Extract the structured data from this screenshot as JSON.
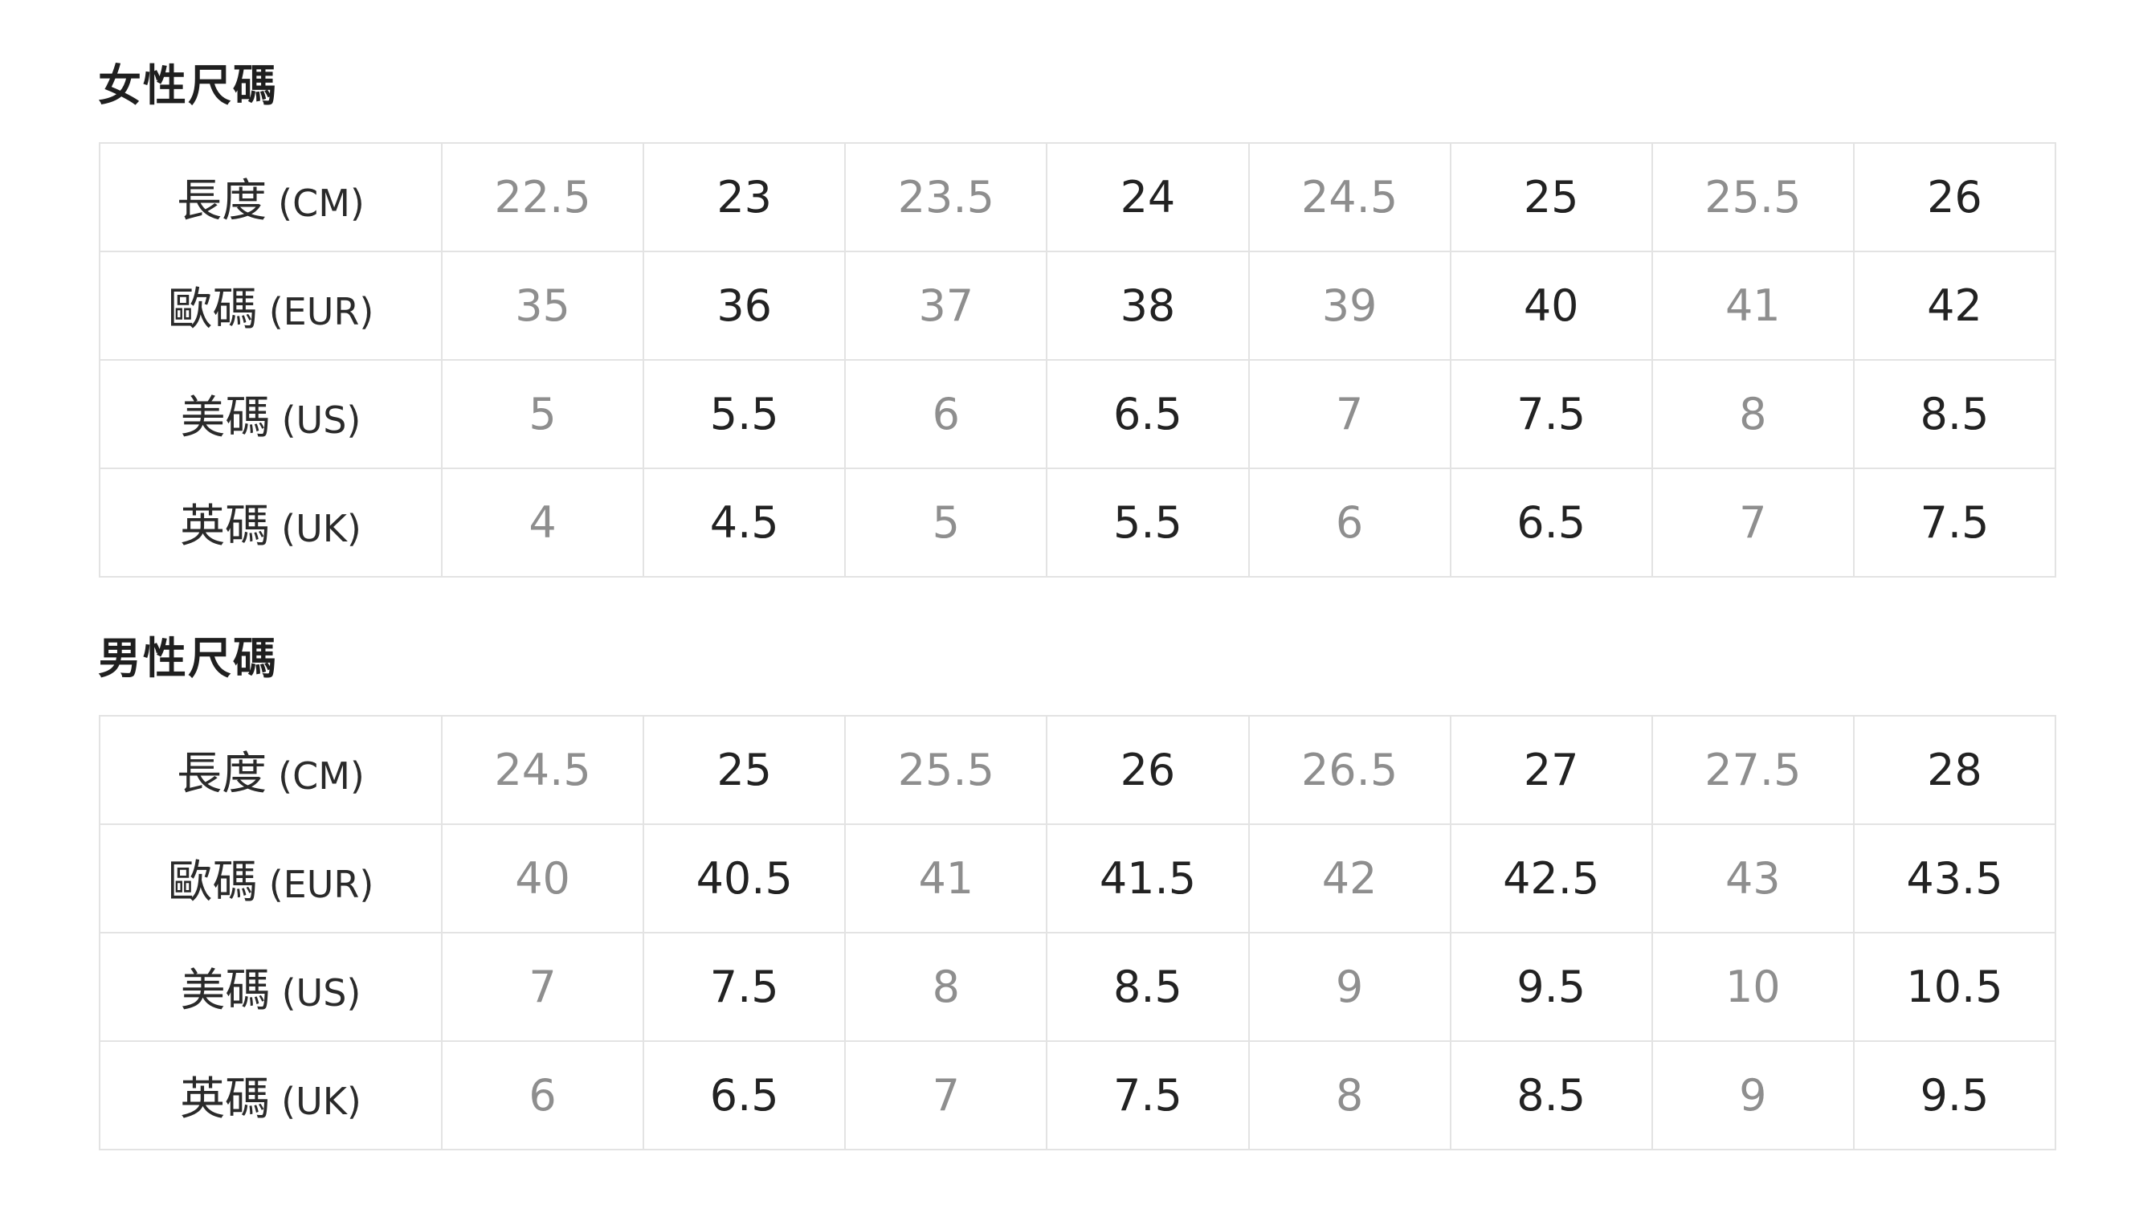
{
  "women": {
    "title": "女性尺碼",
    "rows": [
      {
        "label_zh": "長度",
        "label_unit": "(CM)",
        "values": [
          "22.5",
          "23",
          "23.5",
          "24",
          "24.5",
          "25",
          "25.5",
          "26"
        ]
      },
      {
        "label_zh": "歐碼",
        "label_unit": "(EUR)",
        "values": [
          "35",
          "36",
          "37",
          "38",
          "39",
          "40",
          "41",
          "42"
        ]
      },
      {
        "label_zh": "美碼",
        "label_unit": "(US)",
        "values": [
          "5",
          "5.5",
          "6",
          "6.5",
          "7",
          "7.5",
          "8",
          "8.5"
        ]
      },
      {
        "label_zh": "英碼",
        "label_unit": "(UK)",
        "values": [
          "4",
          "4.5",
          "5",
          "5.5",
          "6",
          "6.5",
          "7",
          "7.5"
        ]
      }
    ]
  },
  "men": {
    "title": "男性尺碼",
    "rows": [
      {
        "label_zh": "長度",
        "label_unit": "(CM)",
        "values": [
          "24.5",
          "25",
          "25.5",
          "26",
          "26.5",
          "27",
          "27.5",
          "28"
        ]
      },
      {
        "label_zh": "歐碼",
        "label_unit": "(EUR)",
        "values": [
          "40",
          "40.5",
          "41",
          "41.5",
          "42",
          "42.5",
          "43",
          "43.5"
        ]
      },
      {
        "label_zh": "美碼",
        "label_unit": "(US)",
        "values": [
          "7",
          "7.5",
          "8",
          "8.5",
          "9",
          "9.5",
          "10",
          "10.5"
        ]
      },
      {
        "label_zh": "英碼",
        "label_unit": "(UK)",
        "values": [
          "6",
          "6.5",
          "7",
          "7.5",
          "8",
          "8.5",
          "9",
          "9.5"
        ]
      }
    ]
  },
  "colors": {
    "light_value": "#8e8e8e",
    "dark_value": "#222222",
    "grid_border": "#e3e3e3"
  }
}
